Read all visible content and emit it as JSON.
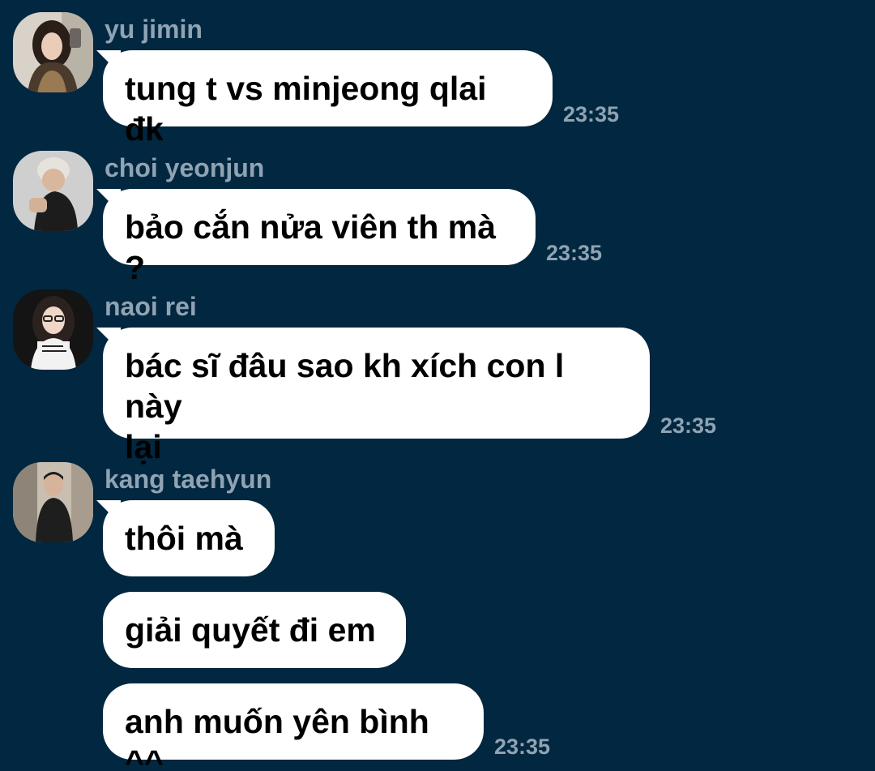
{
  "messages": [
    {
      "sender": "yu jimin",
      "text": "tung t vs minjeong qlai đk",
      "time": "23:35",
      "avatar": "avatar-photo-yu-jimin"
    },
    {
      "sender": "choi yeonjun",
      "text": "bảo cắn nửa viên th mà ?",
      "time": "23:35",
      "avatar": "avatar-photo-choi-yeonjun"
    },
    {
      "sender": "naoi rei",
      "text": "bác sĩ đâu sao kh xích con l này\nlại",
      "time": "23:35",
      "avatar": "avatar-photo-naoi-rei"
    },
    {
      "sender": "kang taehyun",
      "text": "thôi mà",
      "avatar": "avatar-photo-kang-taehyun"
    },
    {
      "text": "giải quyết đi em"
    },
    {
      "text": "anh muốn yên bình ^^",
      "time": "23:35"
    }
  ],
  "colors": {
    "background": "#022740",
    "bubble": "#ffffff",
    "meta_text": "#8fa3b3"
  }
}
